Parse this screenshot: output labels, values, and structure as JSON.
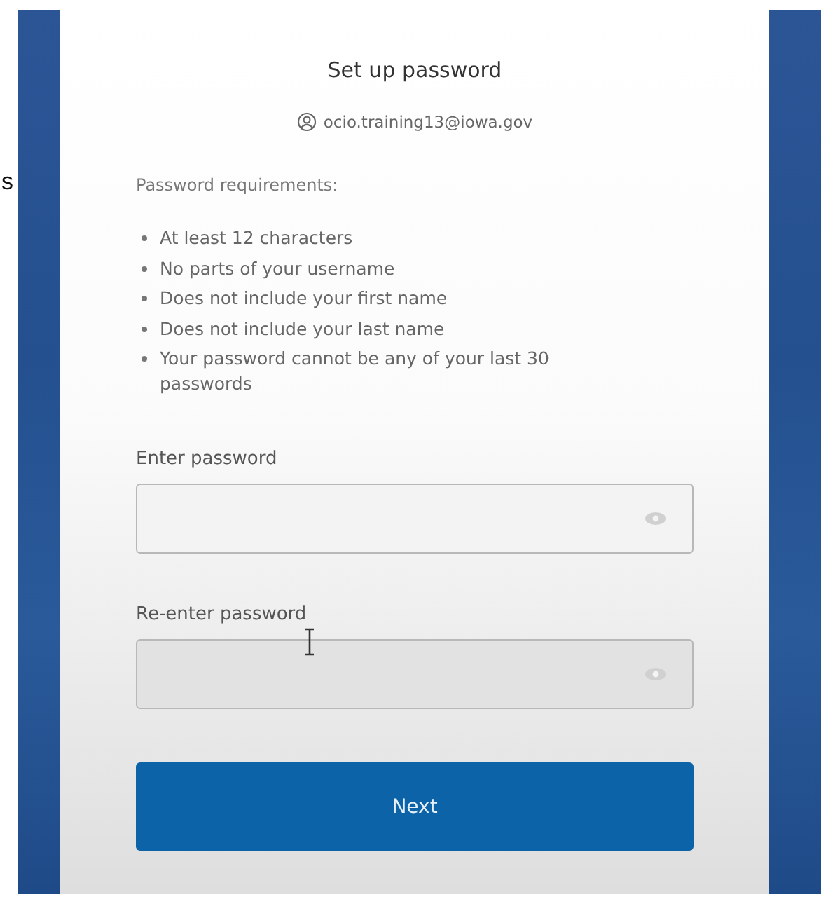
{
  "side_text": "s",
  "card": {
    "title": "Set up password",
    "account": "ocio.training13@iowa.gov",
    "requirements_heading": "Password requirements:",
    "requirements": [
      "At least 12 characters",
      "No parts of your username",
      "Does not include your first name",
      "Does not include your last name",
      "Your password cannot be any of your last 30 passwords"
    ],
    "fields": [
      {
        "label": "Enter password"
      },
      {
        "label": "Re-enter password"
      }
    ],
    "button": "Next"
  }
}
